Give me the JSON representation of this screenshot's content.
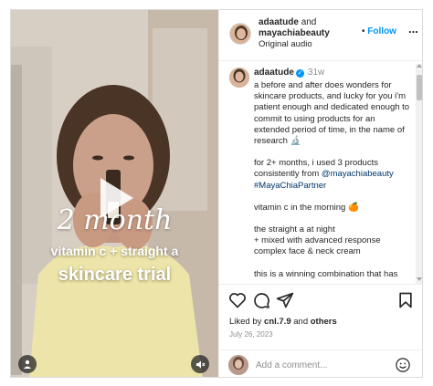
{
  "post": {
    "media": {
      "overlay_line1": "2 month",
      "overlay_line2": "vitamin c + straight a",
      "overlay_line3": "skincare trial",
      "play_icon": "play-icon",
      "user_tag_icon": "person-icon",
      "mute_icon": "speaker-muted-icon"
    },
    "header": {
      "user1": "adaatude",
      "conjunction": "and",
      "user2": "mayachiabeauty",
      "audio_label": "Original audio",
      "follow_separator": "•",
      "follow_label": "Follow",
      "more_label": "..."
    },
    "caption": {
      "username": "adaatude",
      "verified_mark": "✓",
      "time_ago": "31w",
      "para1": "a before and after does wonders for skincare products, and lucky for you i'm patient enough and dedicated enough to commit to using products for an extended period of time, in the name of research 🔬",
      "para2_prefix": "for 2+ months, i used 3 products consistently from ",
      "para2_mention": "@mayachiabeauty",
      "para2_hashtag": "#MayaChiaPartner",
      "para3": "vitamin c in the morning 🍊",
      "para4_line1": "the straight a at night",
      "para4_line2": "+ mixed with advanced response complex face & neck cream",
      "para5": "this is a winning combination that has"
    },
    "actions": {
      "like_icon": "heart-icon",
      "comment_icon": "comment-icon",
      "share_icon": "share-icon",
      "save_icon": "bookmark-icon",
      "likes_prefix": "Liked by",
      "likes_user": "cnl.7.9",
      "likes_and": "and",
      "likes_others": "others",
      "date": "July 26, 2023"
    },
    "add_comment": {
      "placeholder": "Add a comment...",
      "emoji_icon": "smiley-icon"
    }
  }
}
